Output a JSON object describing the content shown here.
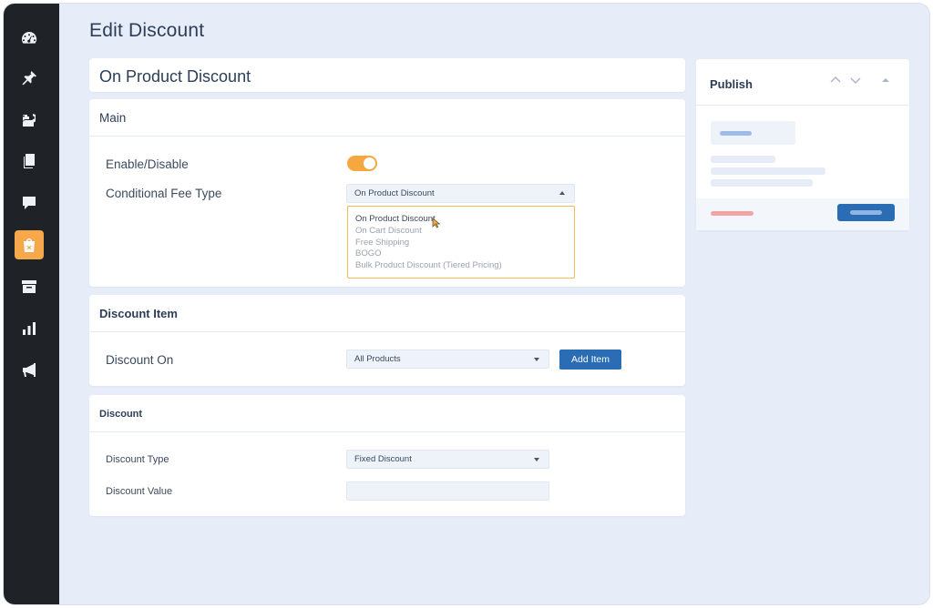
{
  "page": {
    "title": "Edit Discount"
  },
  "sidebar": {
    "items": [
      {
        "icon": "dashboard-icon",
        "active": false
      },
      {
        "icon": "pin-icon",
        "active": false
      },
      {
        "icon": "media-icon",
        "active": false
      },
      {
        "icon": "pages-icon",
        "active": false
      },
      {
        "icon": "comment-icon",
        "active": false
      },
      {
        "icon": "shopping-bag-icon",
        "active": true
      },
      {
        "icon": "archive-icon",
        "active": false
      },
      {
        "icon": "bar-chart-icon",
        "active": false
      },
      {
        "icon": "megaphone-icon",
        "active": false
      }
    ],
    "accent": "#f6a84a"
  },
  "post_title": {
    "value": "On Product Discount"
  },
  "main_section": {
    "title": "Main",
    "enable_label": "Enable/Disable",
    "enabled": true,
    "fee_type_label": "Conditional Fee Type",
    "fee_type_selected": "On Product Discount",
    "fee_type_options": [
      "On Product Discount",
      "On Cart Discount",
      "Free Shipping",
      "BOGO",
      "Bulk Product Discount (Tiered Pricing)"
    ]
  },
  "discount_item_section": {
    "title": "Discount Item",
    "discount_on_label": "Discount On",
    "discount_on_selected": "All Products",
    "add_item_label": "Add Item"
  },
  "discount_section": {
    "title": "Discount",
    "type_label": "Discount Type",
    "type_selected": "Fixed Discount",
    "value_label": "Discount Value",
    "value": ""
  },
  "publish": {
    "title": "Publish"
  },
  "colors": {
    "primary_button": "#2a6db5",
    "toggle_on": "#f6a73f",
    "dropdown_border": "#f2b85a"
  }
}
